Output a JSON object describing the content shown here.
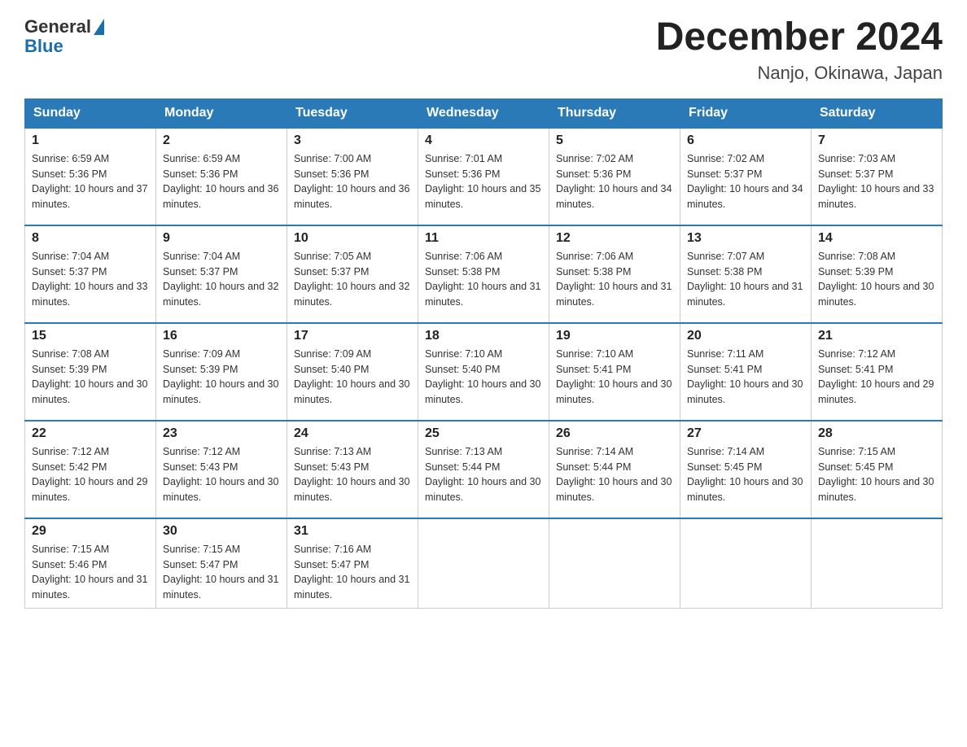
{
  "header": {
    "logo_general": "General",
    "logo_blue": "Blue",
    "month_title": "December 2024",
    "location": "Nanjo, Okinawa, Japan"
  },
  "weekdays": [
    "Sunday",
    "Monday",
    "Tuesday",
    "Wednesday",
    "Thursday",
    "Friday",
    "Saturday"
  ],
  "weeks": [
    [
      {
        "day": "1",
        "sunrise": "6:59 AM",
        "sunset": "5:36 PM",
        "daylight": "10 hours and 37 minutes."
      },
      {
        "day": "2",
        "sunrise": "6:59 AM",
        "sunset": "5:36 PM",
        "daylight": "10 hours and 36 minutes."
      },
      {
        "day": "3",
        "sunrise": "7:00 AM",
        "sunset": "5:36 PM",
        "daylight": "10 hours and 36 minutes."
      },
      {
        "day": "4",
        "sunrise": "7:01 AM",
        "sunset": "5:36 PM",
        "daylight": "10 hours and 35 minutes."
      },
      {
        "day": "5",
        "sunrise": "7:02 AM",
        "sunset": "5:36 PM",
        "daylight": "10 hours and 34 minutes."
      },
      {
        "day": "6",
        "sunrise": "7:02 AM",
        "sunset": "5:37 PM",
        "daylight": "10 hours and 34 minutes."
      },
      {
        "day": "7",
        "sunrise": "7:03 AM",
        "sunset": "5:37 PM",
        "daylight": "10 hours and 33 minutes."
      }
    ],
    [
      {
        "day": "8",
        "sunrise": "7:04 AM",
        "sunset": "5:37 PM",
        "daylight": "10 hours and 33 minutes."
      },
      {
        "day": "9",
        "sunrise": "7:04 AM",
        "sunset": "5:37 PM",
        "daylight": "10 hours and 32 minutes."
      },
      {
        "day": "10",
        "sunrise": "7:05 AM",
        "sunset": "5:37 PM",
        "daylight": "10 hours and 32 minutes."
      },
      {
        "day": "11",
        "sunrise": "7:06 AM",
        "sunset": "5:38 PM",
        "daylight": "10 hours and 31 minutes."
      },
      {
        "day": "12",
        "sunrise": "7:06 AM",
        "sunset": "5:38 PM",
        "daylight": "10 hours and 31 minutes."
      },
      {
        "day": "13",
        "sunrise": "7:07 AM",
        "sunset": "5:38 PM",
        "daylight": "10 hours and 31 minutes."
      },
      {
        "day": "14",
        "sunrise": "7:08 AM",
        "sunset": "5:39 PM",
        "daylight": "10 hours and 30 minutes."
      }
    ],
    [
      {
        "day": "15",
        "sunrise": "7:08 AM",
        "sunset": "5:39 PM",
        "daylight": "10 hours and 30 minutes."
      },
      {
        "day": "16",
        "sunrise": "7:09 AM",
        "sunset": "5:39 PM",
        "daylight": "10 hours and 30 minutes."
      },
      {
        "day": "17",
        "sunrise": "7:09 AM",
        "sunset": "5:40 PM",
        "daylight": "10 hours and 30 minutes."
      },
      {
        "day": "18",
        "sunrise": "7:10 AM",
        "sunset": "5:40 PM",
        "daylight": "10 hours and 30 minutes."
      },
      {
        "day": "19",
        "sunrise": "7:10 AM",
        "sunset": "5:41 PM",
        "daylight": "10 hours and 30 minutes."
      },
      {
        "day": "20",
        "sunrise": "7:11 AM",
        "sunset": "5:41 PM",
        "daylight": "10 hours and 30 minutes."
      },
      {
        "day": "21",
        "sunrise": "7:12 AM",
        "sunset": "5:41 PM",
        "daylight": "10 hours and 29 minutes."
      }
    ],
    [
      {
        "day": "22",
        "sunrise": "7:12 AM",
        "sunset": "5:42 PM",
        "daylight": "10 hours and 29 minutes."
      },
      {
        "day": "23",
        "sunrise": "7:12 AM",
        "sunset": "5:43 PM",
        "daylight": "10 hours and 30 minutes."
      },
      {
        "day": "24",
        "sunrise": "7:13 AM",
        "sunset": "5:43 PM",
        "daylight": "10 hours and 30 minutes."
      },
      {
        "day": "25",
        "sunrise": "7:13 AM",
        "sunset": "5:44 PM",
        "daylight": "10 hours and 30 minutes."
      },
      {
        "day": "26",
        "sunrise": "7:14 AM",
        "sunset": "5:44 PM",
        "daylight": "10 hours and 30 minutes."
      },
      {
        "day": "27",
        "sunrise": "7:14 AM",
        "sunset": "5:45 PM",
        "daylight": "10 hours and 30 minutes."
      },
      {
        "day": "28",
        "sunrise": "7:15 AM",
        "sunset": "5:45 PM",
        "daylight": "10 hours and 30 minutes."
      }
    ],
    [
      {
        "day": "29",
        "sunrise": "7:15 AM",
        "sunset": "5:46 PM",
        "daylight": "10 hours and 31 minutes."
      },
      {
        "day": "30",
        "sunrise": "7:15 AM",
        "sunset": "5:47 PM",
        "daylight": "10 hours and 31 minutes."
      },
      {
        "day": "31",
        "sunrise": "7:16 AM",
        "sunset": "5:47 PM",
        "daylight": "10 hours and 31 minutes."
      },
      null,
      null,
      null,
      null
    ]
  ],
  "labels": {
    "sunrise_prefix": "Sunrise: ",
    "sunset_prefix": "Sunset: ",
    "daylight_prefix": "Daylight: "
  }
}
